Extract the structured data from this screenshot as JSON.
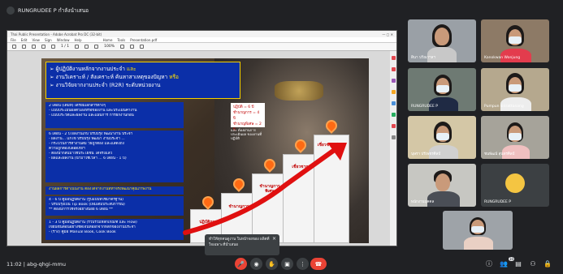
{
  "meeting": {
    "presenter_label": "RUNGRUDEE P กำลังนำเสนอ",
    "clock": "11:02  |  abg-qhgi-mmu"
  },
  "viewer": {
    "title": "Thai Public Presentation  -  Adobe Acrobat Pro DC (32-bit)",
    "menu": [
      "File",
      "Edit",
      "View",
      "Sign",
      "Window",
      "Help"
    ],
    "tabs": [
      "Home",
      "Tools",
      "Presentation.pdf"
    ],
    "page_indicator": "1 / 1",
    "zoom": "100%"
  },
  "slide": {
    "header_lines": [
      {
        "text": "ผู้ปฏิบัติงานหลักจากงานประจำ ",
        "highlight": "และ"
      },
      {
        "text": "งานวิเคราะห์ / สังเคราะห์ ค้นหาสาเหตุของปัญหา ",
        "highlight": "หรือ"
      },
      {
        "text": "งานวิจัยจากงานประจำ (R2R) ระดับหน่วยงาน",
        "highlight": ""
      }
    ],
    "box1": [
      "2 เดือน (เดิมที่) เตรียมเอกสารต่างๆ",
      "- แบบประเมินผลตัวเองหรือของงาน และประเมินค่างาน",
      "- แบบประวัติและผลงาน และแผนการ การฝึกงานก่อน"
    ],
    "box2": [
      "6 เดือน - 2 ปี  ผลงานเก็บ ปรับปรุง พัฒนางาน ประจำ",
      "- ผลงาน... แก้ไข ปรับปรุง พัฒนา งานประจำ ...",
      "- กระบวนการทำงานสม วิธีถูกต้อง และแสดงถึง",
      "  ความถูกต้องปลอดภัยฯ",
      "- ต้องนำกลับมาใช้ประโยชน์ ได้จริงแล้ว",
      "- ผลและผลงาน (นำมาใช้เวลา ... 6 เดือน - 1 ปี)"
    ],
    "box3": "งานผลการดำเนินงาน ต้องได้จากงานที่ทำจริงพัฒนาคุณภาพงาน",
    "box4": [
      "4 - 6 ปี  คู่มือปฏิบัติงาน (รูปแบบที่ใช้มาตรฐาน)",
      "- ปรับปรุงเป็น Tip Book (เพิ่มเติมประสบการณ์)",
      "  ** ต้องมีการใช้จริงอย่างน้อย 6 เดือน **"
    ],
    "box5": [
      "1 - 3 ปี  คู่มือปฏิบัติงาน (รวบรวมหลักเกณฑ์ และ Flow)",
      "เขียนขั้นตอนอย่างชัดเจนที่ออกจากหลักของงานประจำ",
      "- (ร่าง) คู่มือ Manual Book, Cook Book"
    ],
    "years": {
      "lines": [
        "ปฏิบัติ = 6 ปี",
        "ชำนาญการ = 4 ปี",
        "ชำนาญพิเศษ = 2 ปี"
      ],
      "note": "และ ต้องผ่านการประเมินผล ของงานที่ปฏิบัติ"
    },
    "steps": [
      {
        "label": "ปฏิบัติการ"
      },
      {
        "label": "ชำนาญการ"
      },
      {
        "label": "ชำนาญการ พิเศษ"
      },
      {
        "label": "เชี่ยวชาญ"
      },
      {
        "label": "เชี่ยวชาญ พิเศษ"
      }
    ],
    "pin_color": "#ff6a13",
    "arrow_color": "#e01010",
    "box_color": "#0b2fa8"
  },
  "participants": [
    {
      "name": "ดินา ปวีณาฯลฯ",
      "shirt": "#c8c8c8",
      "bg": "#9aa0a6"
    },
    {
      "name": "Kanokwan Wonjung",
      "shirt": "#e33c4d",
      "bg": "#8d7a66"
    },
    {
      "name": "RUNGRUDEE P",
      "shirt": "#1f2a44",
      "bg": "#6e7a73"
    },
    {
      "name": "Pumpun sirirattanang",
      "shirt": "#ededed",
      "bg": "#b5a88e"
    },
    {
      "name": "นุษรา ปรีเพชรศิลป์",
      "shirt": "#d0d0d0",
      "bg": "#d4c7a6"
    },
    {
      "name": "ชนพัฒน์ สุนทรศิลป์",
      "shirt": "#f0c0c0",
      "bg": "#a6a39a"
    },
    {
      "name": "พนักงานบุคคล",
      "shirt": "#4a4e56",
      "bg": "#c7c7c2"
    },
    {
      "name": "RUNGRUDEE P",
      "shirt": "#f4c542",
      "bg": "#3c4043"
    },
    {
      "name": "",
      "shirt": "#e9d0c4",
      "bg": "#9ea3a8"
    }
  ],
  "tooltip": {
    "text_line1": "ทำให้ทุกคนดูงาน ในหน้าจอของ ผลิตที่",
    "text_line2": "ใจเฉพาะที่นำเสนอ",
    "close": "×"
  },
  "controls": {
    "mic": "🎤",
    "camera": "◉",
    "hand": "✋",
    "present": "▣",
    "more": "⋮",
    "hangup": "☎",
    "info": "ⓘ",
    "people": "👥",
    "people_count": "10",
    "chat": "▤",
    "activities": "⚇",
    "lock": "🔒"
  }
}
